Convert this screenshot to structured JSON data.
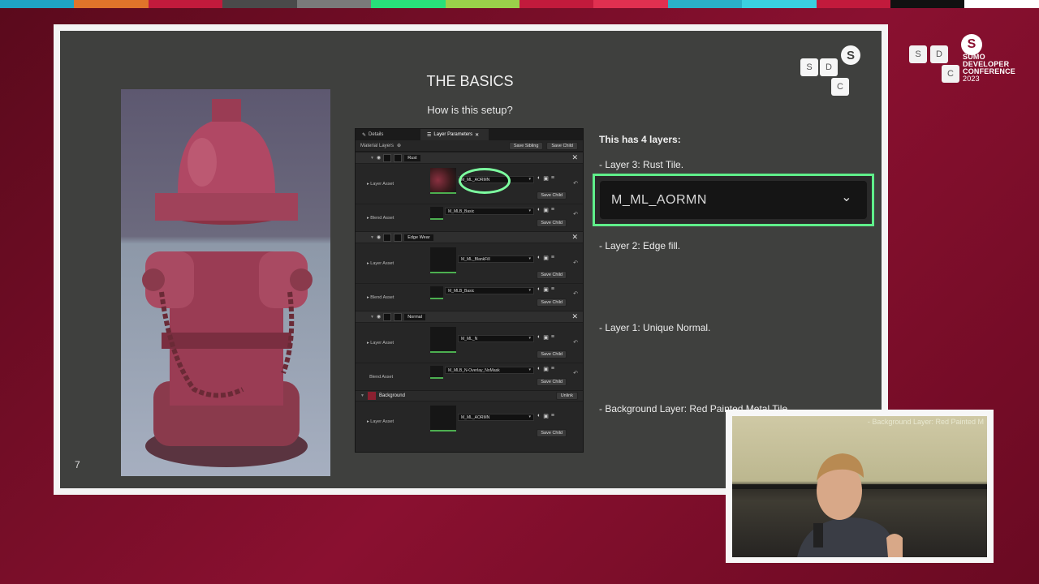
{
  "colors": {
    "accent_green": "#5fef8a",
    "background_red": "#8a1030",
    "slide_bg": "#3f403e"
  },
  "brand": {
    "keys": [
      "S",
      "D",
      "C"
    ],
    "logo_letter": "S",
    "line1": "SUMO",
    "line2": "DEVELOPER",
    "line3": "CONFERENCE",
    "year": "2023"
  },
  "slide": {
    "title": "THE BASICS",
    "subtitle": "How is this setup?",
    "page_number": "7",
    "logo_keys": [
      "S",
      "D",
      "C"
    ],
    "logo_letter": "S"
  },
  "ue_panel": {
    "tabs": [
      {
        "label": "Details",
        "icon": "pencil-icon"
      },
      {
        "label": "Layer Parameters",
        "icon": "layers-icon"
      }
    ],
    "toolbar": {
      "label": "Material Layers",
      "save_sibling": "Save Sibling",
      "save_child": "Save Child"
    },
    "layers": [
      {
        "name": "Rust",
        "layer_asset": "M_ML_AORMN",
        "blend_asset": "M_MLB_Basic"
      },
      {
        "name": "Edge Wear",
        "layer_asset": "M_ML_BlankFill",
        "blend_asset": "M_MLB_Basic"
      },
      {
        "name": "Normal",
        "layer_asset": "M_ML_N",
        "blend_asset": "M_MLB_N-Overlay_NoMask"
      }
    ],
    "background": {
      "name": "Background",
      "unlink": "Unlink",
      "layer_asset": "M_ML_AORMN"
    },
    "labels": {
      "layer_asset": "Layer Asset",
      "blend_asset": "Blend Asset",
      "save_child": "Save Child"
    }
  },
  "notes": {
    "heading": "This has 4 layers:",
    "layer3": "- Layer 3: Rust Tile.",
    "zoomed_asset": "M_ML_AORMN",
    "layer2": "- Layer 2: Edge fill.",
    "layer1": "- Layer 1: Unique Normal.",
    "background": "- Background Layer: Red Painted Metal Tile."
  },
  "webcam": {
    "overlay_text": "- Background Layer: Red Painted M"
  }
}
